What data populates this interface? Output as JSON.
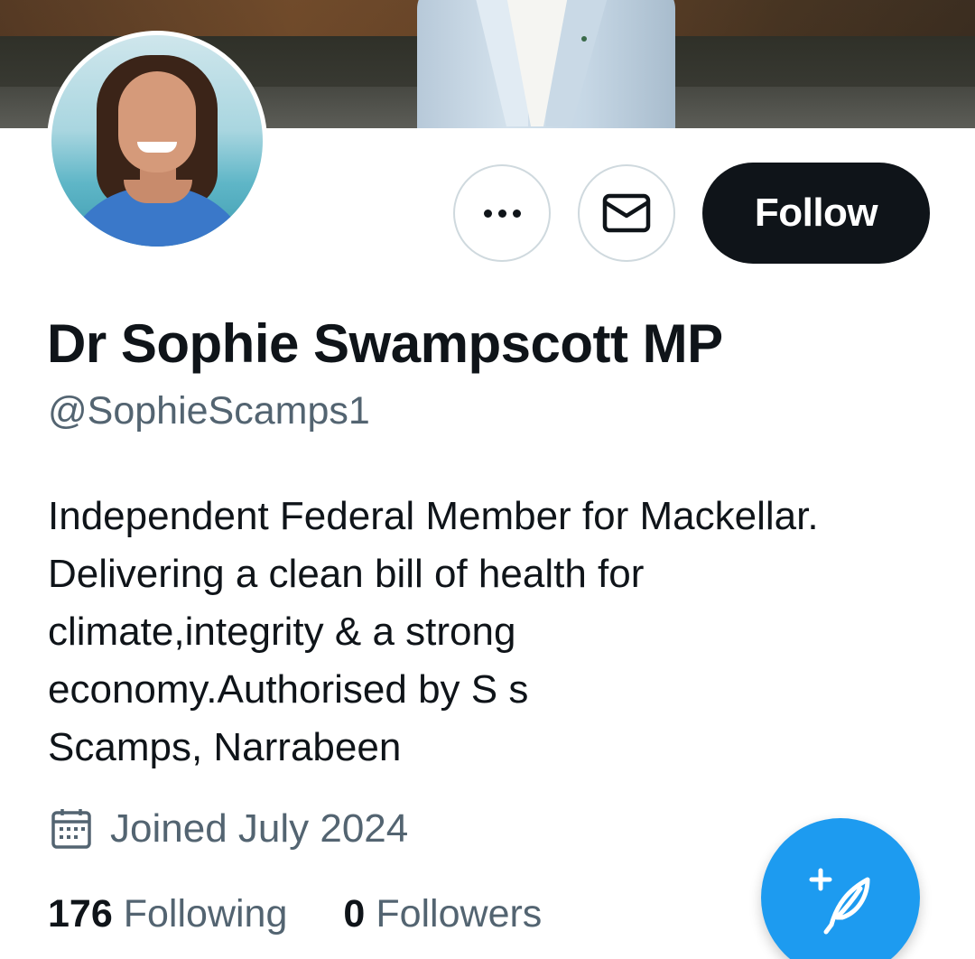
{
  "profile": {
    "display_name": "Dr Sophie Swampscott MP",
    "handle": "@SophieScamps1",
    "bio_lines": [
      "Independent Federal Member for Mackellar.",
      "Delivering a clean bill of health for",
      "climate,integrity & a strong",
      "economy.Authorised by S s",
      "Scamps, Narrabeen"
    ],
    "joined": "Joined July 2024",
    "following_count": "176",
    "following_label": "Following",
    "followers_count": "0",
    "followers_label": "Followers"
  },
  "actions": {
    "more_icon": "more-horizontal-icon",
    "message_icon": "envelope-icon",
    "follow_label": "Follow"
  },
  "icons": {
    "joined": "calendar-icon",
    "compose": "compose-feather-icon"
  },
  "colors": {
    "accent": "#1d9bf0",
    "text_primary": "#0f1419",
    "text_secondary": "#536471",
    "follow_button": "#0f1419"
  }
}
